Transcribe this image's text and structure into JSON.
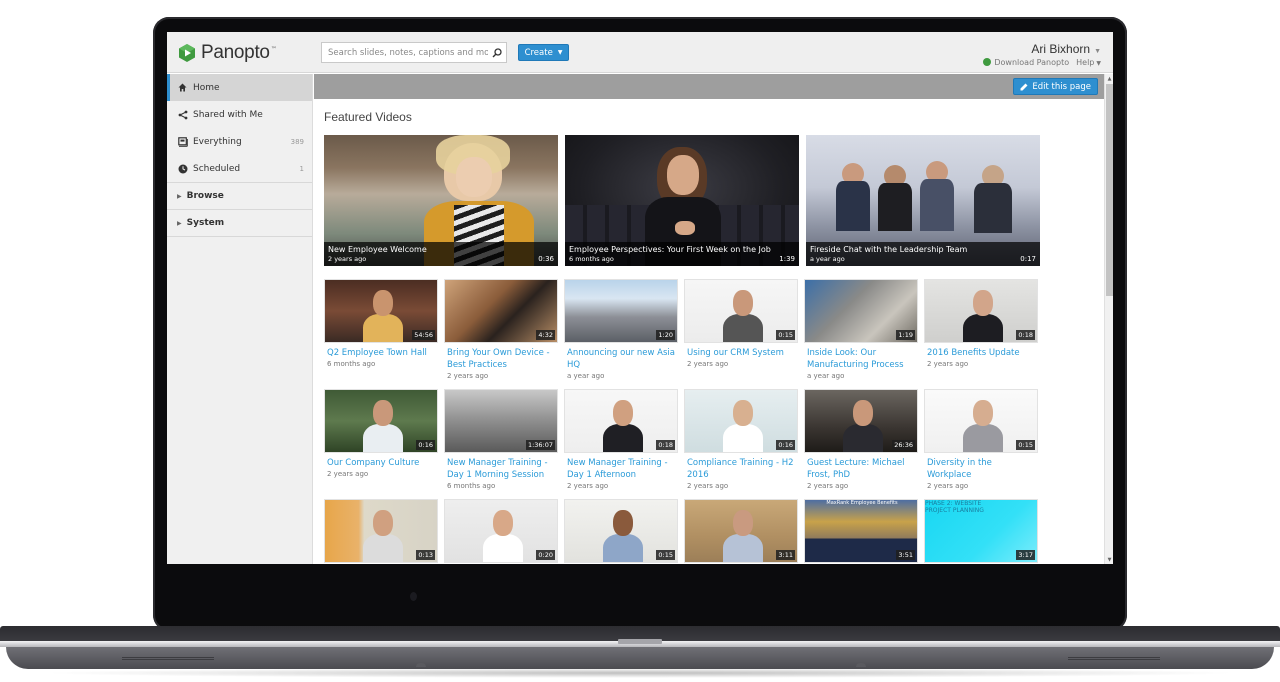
{
  "app": {
    "logo_text": "Panopto",
    "logo_tm": "™",
    "brand_green": "#3f9a3f",
    "accent_blue": "#2e8fd0",
    "link_blue": "#2b9bd8"
  },
  "header": {
    "search_placeholder": "Search slides, notes, captions and more",
    "create_label": "Create",
    "user_name": "Ari Bixhorn",
    "download_label": "Download Panopto",
    "help_label": "Help"
  },
  "sidebar": {
    "items": [
      {
        "label": "Home",
        "icon": "home-icon",
        "count": ""
      },
      {
        "label": "Shared with Me",
        "icon": "share-icon",
        "count": ""
      },
      {
        "label": "Everything",
        "icon": "library-icon",
        "count": "389"
      },
      {
        "label": "Scheduled",
        "icon": "clock-icon",
        "count": "1"
      }
    ],
    "groups": [
      {
        "label": "Browse"
      },
      {
        "label": "System"
      }
    ]
  },
  "main": {
    "edit_label": "Edit this page",
    "section_title": "Featured Videos",
    "featured": [
      {
        "title": "New Employee Welcome",
        "age": "2 years ago",
        "duration": "0:36"
      },
      {
        "title": "Employee Perspectives: Your First Week on the Job",
        "age": "6 months ago",
        "duration": "1:39"
      },
      {
        "title": "Fireside Chat with the Leadership Team",
        "age": "a year ago",
        "duration": "0:17"
      }
    ],
    "videos": [
      {
        "title": "Q2 Employee Town Hall",
        "age": "6 months ago",
        "duration": "54:56"
      },
      {
        "title": "Bring Your Own Device - Best Practices",
        "age": "2 years ago",
        "duration": "4:32"
      },
      {
        "title": "Announcing our new Asia HQ",
        "age": "a year ago",
        "duration": "1:20"
      },
      {
        "title": "Using our CRM System",
        "age": "2 years ago",
        "duration": "0:15"
      },
      {
        "title": "Inside Look: Our Manufacturing Process",
        "age": "a year ago",
        "duration": "1:19"
      },
      {
        "title": "2016 Benefits Update",
        "age": "2 years ago",
        "duration": "0:18"
      },
      {
        "title": "Our Company Culture",
        "age": "2 years ago",
        "duration": "0:16"
      },
      {
        "title": "New Manager Training - Day 1 Morning Session",
        "age": "6 months ago",
        "duration": "1:36:07"
      },
      {
        "title": "New Manager Training - Day 1 Afternoon",
        "age": "2 years ago",
        "duration": "0:18"
      },
      {
        "title": "Compliance Training - H2 2016",
        "age": "2 years ago",
        "duration": "0:16"
      },
      {
        "title": "Guest Lecture: Michael Frost, PhD",
        "age": "2 years ago",
        "duration": "26:36"
      },
      {
        "title": "Diversity in the Workplace",
        "age": "2 years ago",
        "duration": "0:15"
      },
      {
        "title": "",
        "age": "",
        "duration": "0:13"
      },
      {
        "title": "",
        "age": "",
        "duration": "0:20"
      },
      {
        "title": "",
        "age": "",
        "duration": "0:15"
      },
      {
        "title": "",
        "age": "",
        "duration": "3:11"
      },
      {
        "title": "",
        "age": "",
        "duration": "3:51",
        "slide_text": "MaxRank Employee Benefits"
      },
      {
        "title": "",
        "age": "",
        "duration": "3:17",
        "slide_text": "PHASE 2: WEBSITE PROJECT PLANNING"
      }
    ]
  }
}
